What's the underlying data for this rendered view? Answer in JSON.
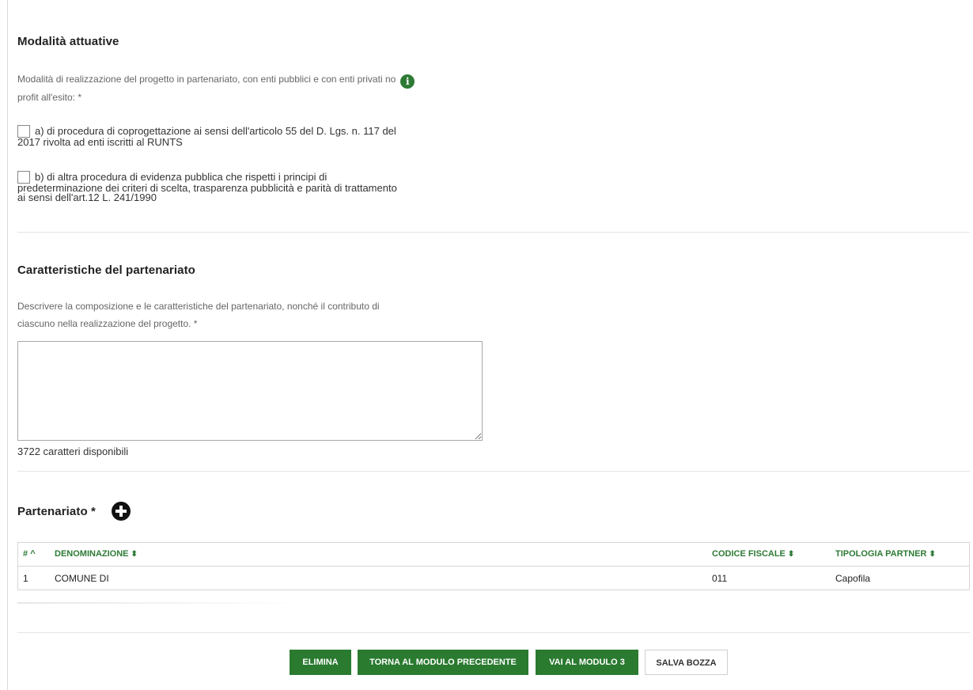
{
  "section1": {
    "title": "Modalità attuative",
    "hint_line1": "Modalità di realizzazione del progetto in partenariato, con enti pubblici e con enti privati no",
    "hint_line2": "profit all'esito: *",
    "options": [
      {
        "line1": "a) di procedura di coprogettazione ai sensi dell'articolo 55 del D. Lgs. n. 117 del",
        "line2": "2017 rivolta ad enti iscritti al RUNTS",
        "line3": "",
        "checked": false
      },
      {
        "line1": "b) di altra procedura di evidenza pubblica che rispetti i principi di",
        "line2": "predeterminazione dei criteri di scelta, trasparenza pubblicità e parità di trattamento",
        "line3": "ai sensi dell'art.12 L. 241/1990",
        "checked": false
      }
    ]
  },
  "section2": {
    "title": "Caratteristiche del partenariato",
    "hint_line1": "Descrivere la composizione e le caratteristiche del partenariato, nonché il contributo di",
    "hint_line2": "ciascuno nella realizzazione del progetto. *",
    "textarea_value": "",
    "counter": "3722 caratteri disponibili"
  },
  "section3": {
    "title": "Partenariato *",
    "columns": {
      "index": "#",
      "index_sort": "^",
      "name": "DENOMINAZIONE",
      "tax_code": "CODICE FISCALE",
      "type": "TIPOLOGIA PARTNER",
      "sort_glyph": "⬍"
    },
    "rows": [
      {
        "index": "1",
        "name": "COMUNE DI",
        "tax_code": "011",
        "type": "Capofila"
      }
    ]
  },
  "buttons": {
    "delete": "ELIMINA",
    "back": "TORNA AL MODULO PRECEDENTE",
    "next": "VAI AL MODULO 3",
    "save_draft": "SALVA BOZZA"
  },
  "colors": {
    "accent": "#2a7a30",
    "info": "#2d7a35"
  },
  "icons": {
    "info": "info-icon",
    "add": "plus-circle-icon"
  }
}
